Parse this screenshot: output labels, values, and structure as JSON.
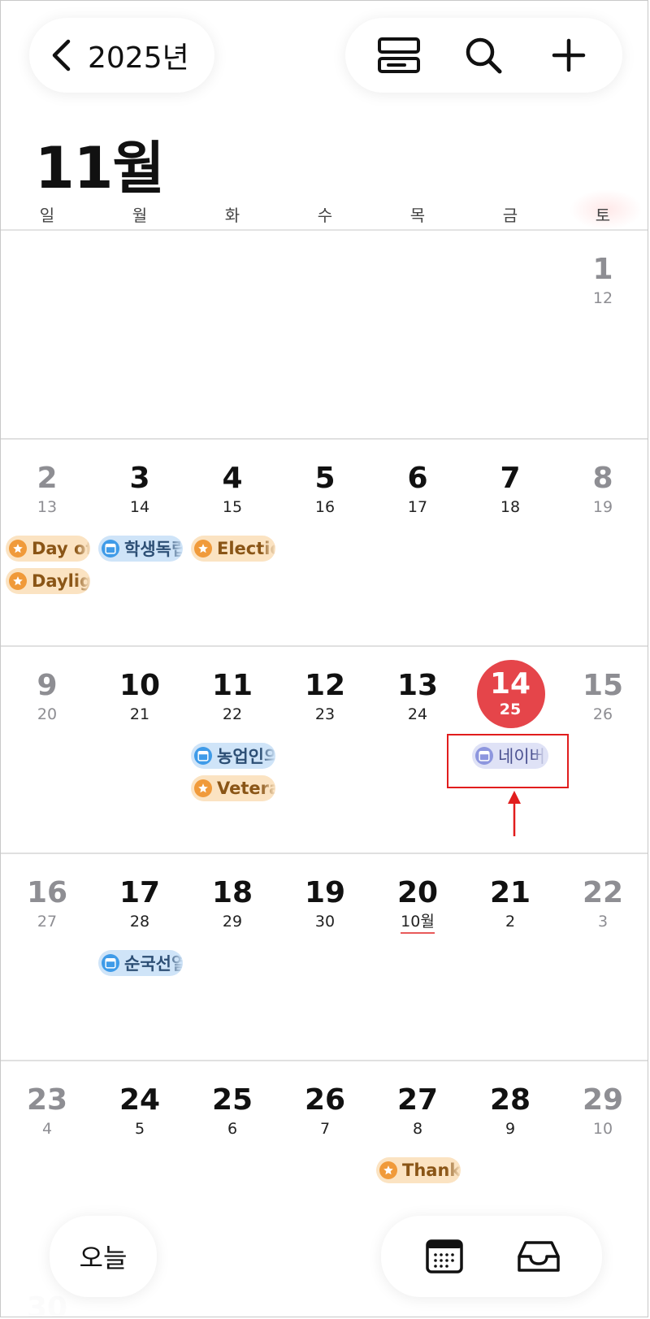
{
  "nav": {
    "year_label": "2025년"
  },
  "month_title": "11월",
  "weekdays": [
    "일",
    "월",
    "화",
    "수",
    "목",
    "금",
    "토"
  ],
  "weeks": [
    {
      "days": [
        null,
        null,
        null,
        null,
        null,
        null,
        {
          "num": "1",
          "lunar": "12",
          "weekend": true
        }
      ]
    },
    {
      "days": [
        {
          "num": "2",
          "lunar": "13",
          "weekend": true,
          "events": [
            {
              "label": "Day of the Dead",
              "kind": "holiday"
            },
            {
              "label": "Daylight Saving Time ends",
              "kind": "holiday"
            }
          ]
        },
        {
          "num": "3",
          "lunar": "14",
          "events": [
            {
              "label": "학생독립운동기념일",
              "kind": "cal"
            }
          ]
        },
        {
          "num": "4",
          "lunar": "15",
          "events": [
            {
              "label": "Election Day",
              "kind": "holiday"
            }
          ]
        },
        {
          "num": "5",
          "lunar": "16"
        },
        {
          "num": "6",
          "lunar": "17"
        },
        {
          "num": "7",
          "lunar": "18"
        },
        {
          "num": "8",
          "lunar": "19",
          "weekend": true
        }
      ]
    },
    {
      "days": [
        {
          "num": "9",
          "lunar": "20",
          "weekend": true
        },
        {
          "num": "10",
          "lunar": "21"
        },
        {
          "num": "11",
          "lunar": "22",
          "events": [
            {
              "label": "농업인의 날",
              "kind": "cal"
            },
            {
              "label": "Veterans Day",
              "kind": "holiday"
            }
          ]
        },
        {
          "num": "12",
          "lunar": "23"
        },
        {
          "num": "13",
          "lunar": "24"
        },
        {
          "num": "14",
          "lunar": "25",
          "today": true,
          "events": [
            {
              "label": "네이버",
              "kind": "naver"
            }
          ]
        },
        {
          "num": "15",
          "lunar": "26",
          "weekend": true
        }
      ]
    },
    {
      "days": [
        {
          "num": "16",
          "lunar": "27",
          "weekend": true
        },
        {
          "num": "17",
          "lunar": "28",
          "events": [
            {
              "label": "순국선열의 날",
              "kind": "cal"
            }
          ]
        },
        {
          "num": "18",
          "lunar": "29"
        },
        {
          "num": "19",
          "lunar": "30"
        },
        {
          "num": "20",
          "lunar": "10월",
          "lunar_month_start": true
        },
        {
          "num": "21",
          "lunar": "2"
        },
        {
          "num": "22",
          "lunar": "3",
          "weekend": true
        }
      ]
    },
    {
      "days": [
        {
          "num": "23",
          "lunar": "4",
          "weekend": true
        },
        {
          "num": "24",
          "lunar": "5"
        },
        {
          "num": "25",
          "lunar": "6"
        },
        {
          "num": "26",
          "lunar": "7"
        },
        {
          "num": "27",
          "lunar": "8",
          "events": [
            {
              "label": "Thanksgiving",
              "kind": "holiday"
            }
          ]
        },
        {
          "num": "28",
          "lunar": "9"
        },
        {
          "num": "29",
          "lunar": "10",
          "weekend": true
        }
      ]
    }
  ],
  "next_week_first": "30",
  "bottom": {
    "today_label": "오늘"
  },
  "colors": {
    "today": "#e5454a",
    "highlight": "#e11d1d",
    "holiday_bg": "#fbe3c2",
    "calendar_bg": "#cfe4f8"
  },
  "icons": [
    "chevron-left-icon",
    "view-toggle-icon",
    "search-icon",
    "plus-icon",
    "calendar-icon",
    "inbox-icon",
    "star-icon"
  ]
}
